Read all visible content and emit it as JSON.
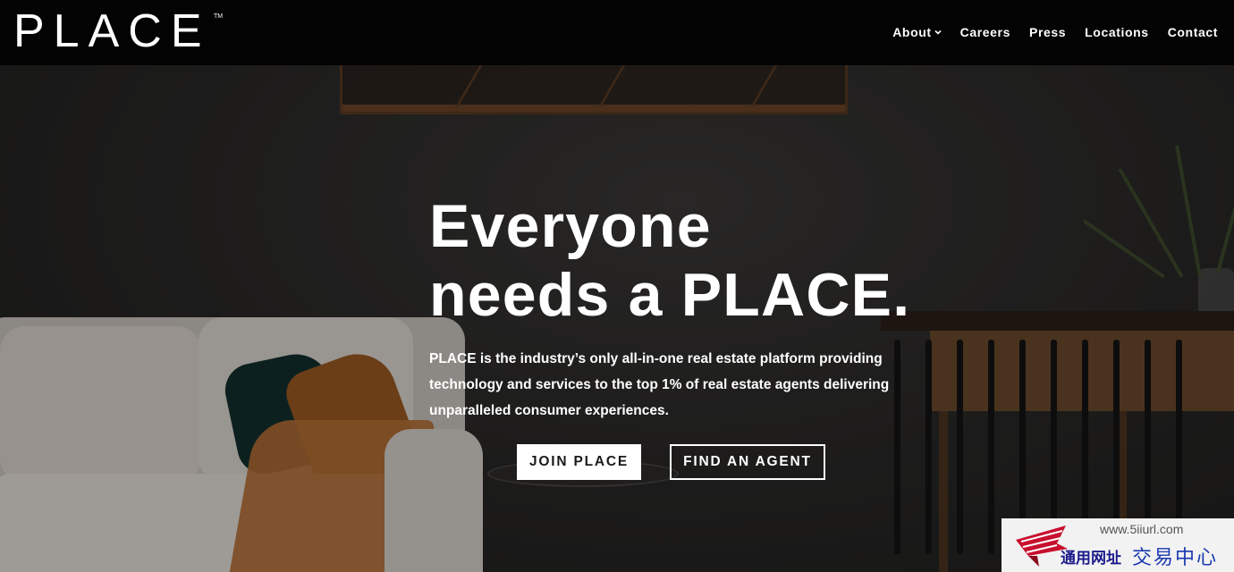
{
  "brand": {
    "name": "PLACE",
    "trademark": "TM"
  },
  "nav": {
    "items": [
      {
        "label": "About",
        "has_dropdown": true
      },
      {
        "label": "Careers"
      },
      {
        "label": "Press"
      },
      {
        "label": "Locations"
      },
      {
        "label": "Contact"
      }
    ]
  },
  "hero": {
    "title_line1": "Everyone",
    "title_line2": "needs a PLACE.",
    "description": "PLACE is the industry’s only all-in-one real estate platform providing technology and services to the top 1% of real estate agents delivering unparalleled consumer experiences.",
    "primary_button": "JOIN PLACE",
    "secondary_button": "FIND AN AGENT"
  },
  "watermark": {
    "url": "www.5iiurl.com",
    "text_left": "通用网址",
    "text_right": "交易中心"
  },
  "colors": {
    "header_bg": "#030303",
    "text": "#ffffff",
    "button_fill": "#ffffff",
    "button_text": "#1a1a1a"
  }
}
